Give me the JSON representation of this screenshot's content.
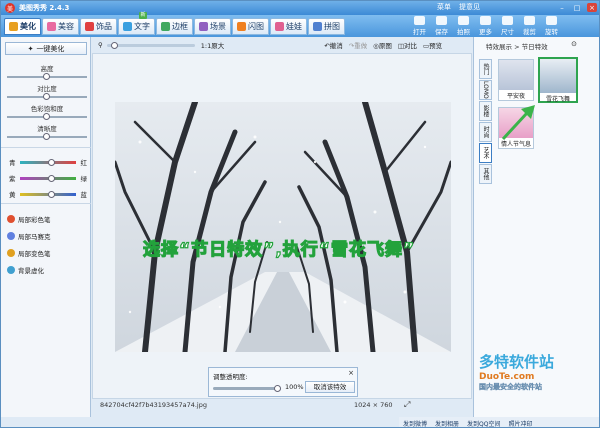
{
  "app": {
    "title": "美图秀秀 2.4.3",
    "logo_letter": "美"
  },
  "top_menu": [
    "菜单",
    "提意见"
  ],
  "tabs": [
    {
      "label": "美化",
      "color": "#e8a020",
      "active": true
    },
    {
      "label": "美容",
      "color": "#e86aa0",
      "active": false
    },
    {
      "label": "饰品",
      "color": "#e04040",
      "active": false
    },
    {
      "label": "文字",
      "color": "#3aa0e0",
      "active": false
    },
    {
      "label": "边框",
      "color": "#40a860",
      "active": false
    },
    {
      "label": "场景",
      "color": "#9060c0",
      "active": false
    },
    {
      "label": "闪图",
      "color": "#f08020",
      "active": false
    },
    {
      "label": "娃娃",
      "color": "#e06090",
      "active": false
    },
    {
      "label": "拼图",
      "color": "#5080d0",
      "active": false
    }
  ],
  "new_badge": "新",
  "tools": [
    "打开",
    "保存",
    "拍照",
    "更多",
    "尺寸",
    "裁剪",
    "旋转"
  ],
  "left": {
    "one_click": "一键美化",
    "sliders": [
      {
        "label": "高度",
        "value": 0.5
      },
      {
        "label": "对比度",
        "value": 0.5
      },
      {
        "label": "色彩饱和度",
        "value": 0.5
      },
      {
        "label": "清晰度",
        "value": 0.5
      }
    ],
    "colors": [
      {
        "left": "青",
        "right": "红",
        "from": "#2bb3c0",
        "to": "#e04040"
      },
      {
        "left": "紫",
        "right": "绿",
        "from": "#b040c0",
        "to": "#40b040"
      },
      {
        "left": "黄",
        "right": "蓝",
        "from": "#e0c020",
        "to": "#3060d0"
      }
    ],
    "tool_items": [
      {
        "label": "局部彩色笔",
        "color": "#e05030"
      },
      {
        "label": "局部马赛克",
        "color": "#6080e0"
      },
      {
        "label": "局部变色笔",
        "color": "#e0a020"
      },
      {
        "label": "背景虚化",
        "color": "#40a0d0"
      }
    ]
  },
  "canvas_bar": {
    "zoom_label": "1:1原大",
    "undo": "撤消",
    "redo": "重做",
    "original": "原图",
    "compare": "对比",
    "preview": "预览"
  },
  "overlay_text": "选择“节日特效”,执行“雪花飞舞”",
  "transparency": {
    "label": "调整透明度:",
    "percent": "100%",
    "cancel": "取消该特效",
    "value": 1.0
  },
  "status": {
    "filename": "842704cf42f7b43193457a74.jpg",
    "size": "1024 × 760"
  },
  "right": {
    "breadcrumb": "特效展示 > 节日特效",
    "vtabs": [
      "热门",
      "LOMO",
      "影楼",
      "时尚",
      "艺术",
      "其他"
    ],
    "thumbs": [
      {
        "caption": "平安夜",
        "selected": false,
        "color": "#b8c4d8"
      },
      {
        "caption": "雪花飞舞",
        "selected": true,
        "color": "#9fb6cc"
      },
      {
        "caption": "情人节气息",
        "selected": false,
        "color": "#e8a0c8"
      }
    ]
  },
  "watermark": "多特软件站",
  "watermark_sub": "DuoTe.com",
  "watermark_cn": "国内最安全的软件站",
  "footer_links": [
    "发到微博",
    "发到相册",
    "发到QQ空间",
    "照片冲印"
  ]
}
